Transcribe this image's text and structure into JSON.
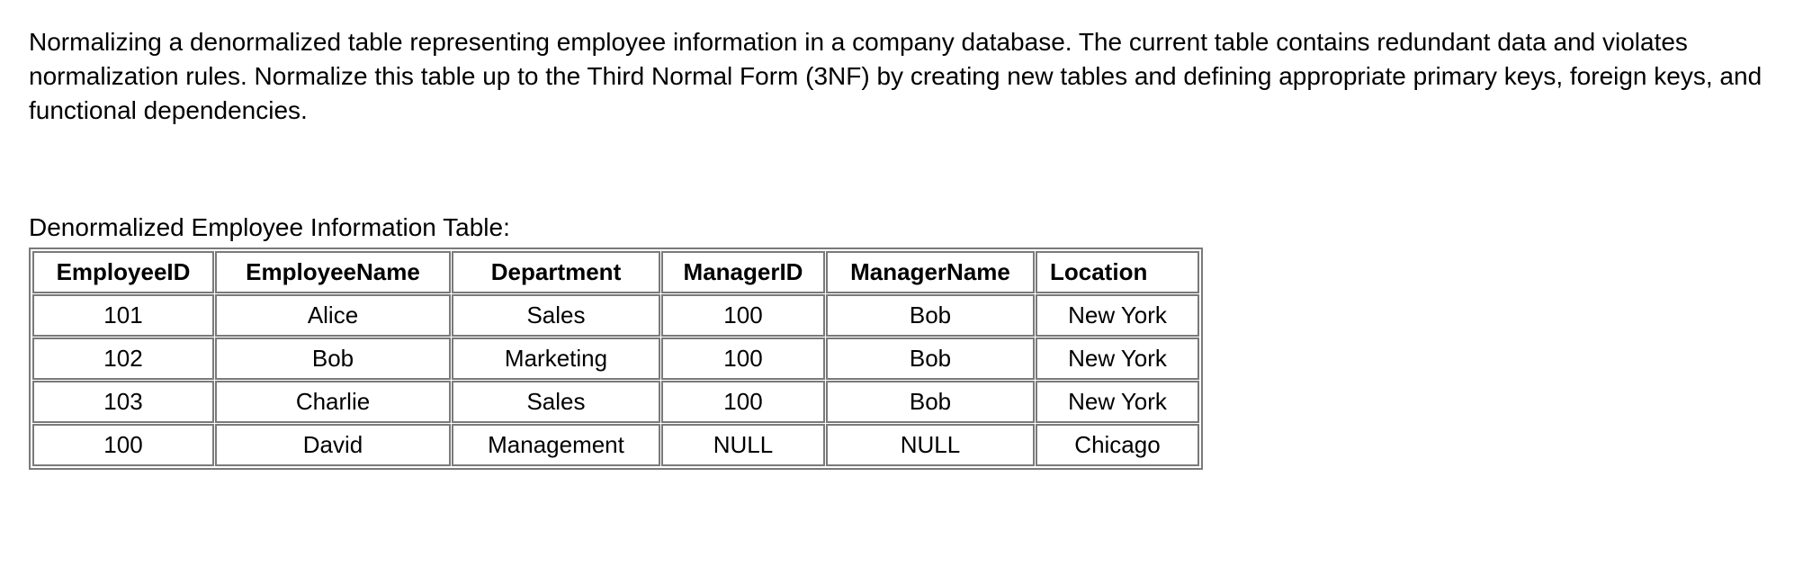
{
  "intro_text": "Normalizing a denormalized table representing employee information in a company database. The current table contains redundant data and violates normalization rules. Normalize this table up to the Third Normal Form (3NF) by creating new tables and defining appropriate primary keys, foreign keys, and functional dependencies.",
  "table_title": "Denormalized Employee Information Table:",
  "table": {
    "headers": [
      "EmployeeID",
      "EmployeeName",
      "Department",
      "ManagerID",
      "ManagerName",
      "Location"
    ],
    "rows": [
      {
        "EmployeeID": "101",
        "EmployeeName": "Alice",
        "Department": "Sales",
        "ManagerID": "100",
        "ManagerName": "Bob",
        "Location": "New York"
      },
      {
        "EmployeeID": "102",
        "EmployeeName": "Bob",
        "Department": "Marketing",
        "ManagerID": "100",
        "ManagerName": "Bob",
        "Location": "New York"
      },
      {
        "EmployeeID": "103",
        "EmployeeName": "Charlie",
        "Department": "Sales",
        "ManagerID": "100",
        "ManagerName": "Bob",
        "Location": "New York"
      },
      {
        "EmployeeID": "100",
        "EmployeeName": "David",
        "Department": "Management",
        "ManagerID": "NULL",
        "ManagerName": "NULL",
        "Location": "Chicago"
      }
    ]
  },
  "chart_data": {
    "type": "table",
    "title": "Denormalized Employee Information Table",
    "columns": [
      "EmployeeID",
      "EmployeeName",
      "Department",
      "ManagerID",
      "ManagerName",
      "Location"
    ],
    "data": [
      [
        101,
        "Alice",
        "Sales",
        100,
        "Bob",
        "New York"
      ],
      [
        102,
        "Bob",
        "Marketing",
        100,
        "Bob",
        "New York"
      ],
      [
        103,
        "Charlie",
        "Sales",
        100,
        "Bob",
        "New York"
      ],
      [
        100,
        "David",
        "Management",
        null,
        null,
        "Chicago"
      ]
    ]
  }
}
